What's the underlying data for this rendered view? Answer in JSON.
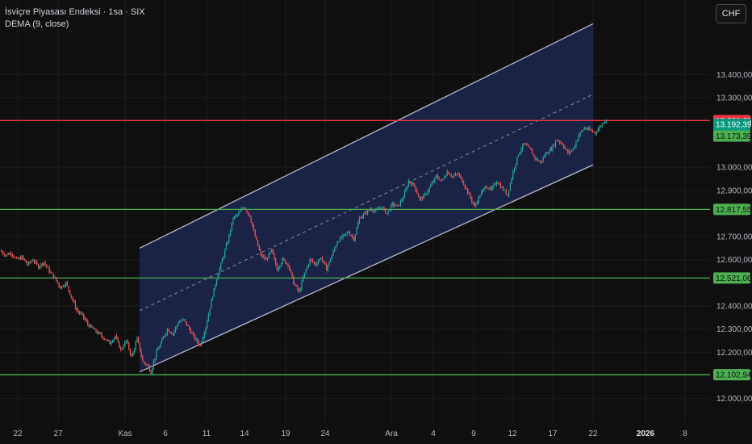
{
  "legend": {
    "title": "İsviçre Piyasası Endeksi · 1sa · SIX",
    "indicator": "DEMA (9, close)"
  },
  "currency_button": "CHF",
  "chart_data": {
    "type": "candlestick",
    "title": "İsviçre Piyasası Endeksi · 1sa · SIX",
    "ylim": [
      11950,
      13660
    ],
    "y_ticks": [
      {
        "value": 12000,
        "label": "12.000,00"
      },
      {
        "value": 12200,
        "label": "12.200,00"
      },
      {
        "value": 12300,
        "label": "12.300,00"
      },
      {
        "value": 12400,
        "label": "12.400,00"
      },
      {
        "value": 12600,
        "label": "12.600,00"
      },
      {
        "value": 12700,
        "label": "12.700,00"
      },
      {
        "value": 12900,
        "label": "12.900,00"
      },
      {
        "value": 13000,
        "label": "13.000,00"
      },
      {
        "value": 13300,
        "label": "13.300,00"
      },
      {
        "value": 13400,
        "label": "13.400,00"
      }
    ],
    "x_ticks": [
      {
        "label": "22",
        "bold": false
      },
      {
        "label": "27",
        "bold": false
      },
      {
        "label": "Kas",
        "bold": false
      },
      {
        "label": "6",
        "bold": false
      },
      {
        "label": "11",
        "bold": false
      },
      {
        "label": "14",
        "bold": false
      },
      {
        "label": "19",
        "bold": false
      },
      {
        "label": "24",
        "bold": false
      },
      {
        "label": "Ara",
        "bold": false
      },
      {
        "label": "4",
        "bold": false
      },
      {
        "label": "9",
        "bold": false
      },
      {
        "label": "12",
        "bold": false
      },
      {
        "label": "17",
        "bold": false
      },
      {
        "label": "22",
        "bold": false
      },
      {
        "label": "2026",
        "bold": true
      },
      {
        "label": "8",
        "bold": false
      }
    ],
    "price_path": [
      [
        0,
        12640
      ],
      [
        4,
        12620
      ],
      [
        8,
        12630
      ],
      [
        12,
        12600
      ],
      [
        16,
        12610
      ],
      [
        20,
        12580
      ],
      [
        24,
        12600
      ],
      [
        28,
        12570
      ],
      [
        32,
        12590
      ],
      [
        36,
        12550
      ],
      [
        40,
        12520
      ],
      [
        44,
        12480
      ],
      [
        48,
        12500
      ],
      [
        52,
        12440
      ],
      [
        56,
        12380
      ],
      [
        60,
        12360
      ],
      [
        64,
        12320
      ],
      [
        68,
        12300
      ],
      [
        72,
        12280
      ],
      [
        76,
        12260
      ],
      [
        80,
        12240
      ],
      [
        84,
        12270
      ],
      [
        88,
        12210
      ],
      [
        92,
        12250
      ],
      [
        96,
        12180
      ],
      [
        100,
        12260
      ],
      [
        104,
        12160
      ],
      [
        108,
        12140
      ],
      [
        110,
        12115
      ],
      [
        114,
        12200
      ],
      [
        118,
        12250
      ],
      [
        122,
        12300
      ],
      [
        126,
        12280
      ],
      [
        130,
        12330
      ],
      [
        134,
        12340
      ],
      [
        138,
        12300
      ],
      [
        142,
        12260
      ],
      [
        146,
        12230
      ],
      [
        150,
        12310
      ],
      [
        154,
        12420
      ],
      [
        158,
        12520
      ],
      [
        162,
        12600
      ],
      [
        166,
        12680
      ],
      [
        170,
        12780
      ],
      [
        174,
        12800
      ],
      [
        178,
        12830
      ],
      [
        182,
        12790
      ],
      [
        186,
        12700
      ],
      [
        190,
        12620
      ],
      [
        194,
        12600
      ],
      [
        198,
        12640
      ],
      [
        202,
        12560
      ],
      [
        206,
        12600
      ],
      [
        210,
        12580
      ],
      [
        214,
        12500
      ],
      [
        218,
        12460
      ],
      [
        222,
        12540
      ],
      [
        226,
        12600
      ],
      [
        230,
        12580
      ],
      [
        234,
        12610
      ],
      [
        238,
        12560
      ],
      [
        242,
        12620
      ],
      [
        246,
        12680
      ],
      [
        250,
        12700
      ],
      [
        254,
        12720
      ],
      [
        258,
        12690
      ],
      [
        262,
        12780
      ],
      [
        266,
        12800
      ],
      [
        270,
        12820
      ],
      [
        274,
        12810
      ],
      [
        278,
        12830
      ],
      [
        282,
        12800
      ],
      [
        286,
        12840
      ],
      [
        290,
        12830
      ],
      [
        294,
        12870
      ],
      [
        298,
        12940
      ],
      [
        302,
        12920
      ],
      [
        306,
        12860
      ],
      [
        310,
        12880
      ],
      [
        314,
        12920
      ],
      [
        318,
        12960
      ],
      [
        322,
        12940
      ],
      [
        326,
        12980
      ],
      [
        330,
        12960
      ],
      [
        334,
        12970
      ],
      [
        338,
        12930
      ],
      [
        342,
        12880
      ],
      [
        346,
        12830
      ],
      [
        350,
        12880
      ],
      [
        354,
        12920
      ],
      [
        358,
        12900
      ],
      [
        362,
        12940
      ],
      [
        366,
        12910
      ],
      [
        370,
        12880
      ],
      [
        374,
        12980
      ],
      [
        378,
        13060
      ],
      [
        382,
        13100
      ],
      [
        386,
        13080
      ],
      [
        390,
        13040
      ],
      [
        394,
        13020
      ],
      [
        398,
        13060
      ],
      [
        402,
        13080
      ],
      [
        406,
        13120
      ],
      [
        410,
        13100
      ],
      [
        414,
        13060
      ],
      [
        418,
        13080
      ],
      [
        422,
        13140
      ],
      [
        426,
        13170
      ],
      [
        430,
        13160
      ],
      [
        434,
        13150
      ],
      [
        438,
        13180
      ],
      [
        442,
        13210
      ]
    ],
    "channel": {
      "upper": {
        "start": [
          173,
          12650
        ],
        "end": [
          735,
          13620
        ]
      },
      "lower": {
        "start": [
          173,
          12115
        ],
        "end": [
          735,
          13010
        ]
      },
      "mid": {
        "start": [
          173,
          12380
        ],
        "end": [
          735,
          13315
        ]
      }
    },
    "horizontal_levels": [
      {
        "value": 13201.66,
        "label": "13.201,66",
        "kind": "resistance"
      },
      {
        "value": 12817.55,
        "label": "12.817,55",
        "kind": "support"
      },
      {
        "value": 12521.06,
        "label": "12.521,06",
        "kind": "support"
      },
      {
        "value": 12102.94,
        "label": "12.102,94",
        "kind": "support"
      }
    ],
    "price_tags": [
      {
        "value": 13192.39,
        "label": "13.192,39",
        "sublabel": "51:38",
        "kind": "last"
      },
      {
        "value": 13173.39,
        "label": "13.173,39",
        "kind": "dema"
      }
    ],
    "colors": {
      "up": "#26a69a",
      "down": "#ef5350",
      "channel_fill": "#1f2a59",
      "channel_line": "#b6bad0",
      "resistance": "#f23645",
      "support": "#4caf50",
      "background": "#0f0f0f"
    },
    "grid": true
  }
}
